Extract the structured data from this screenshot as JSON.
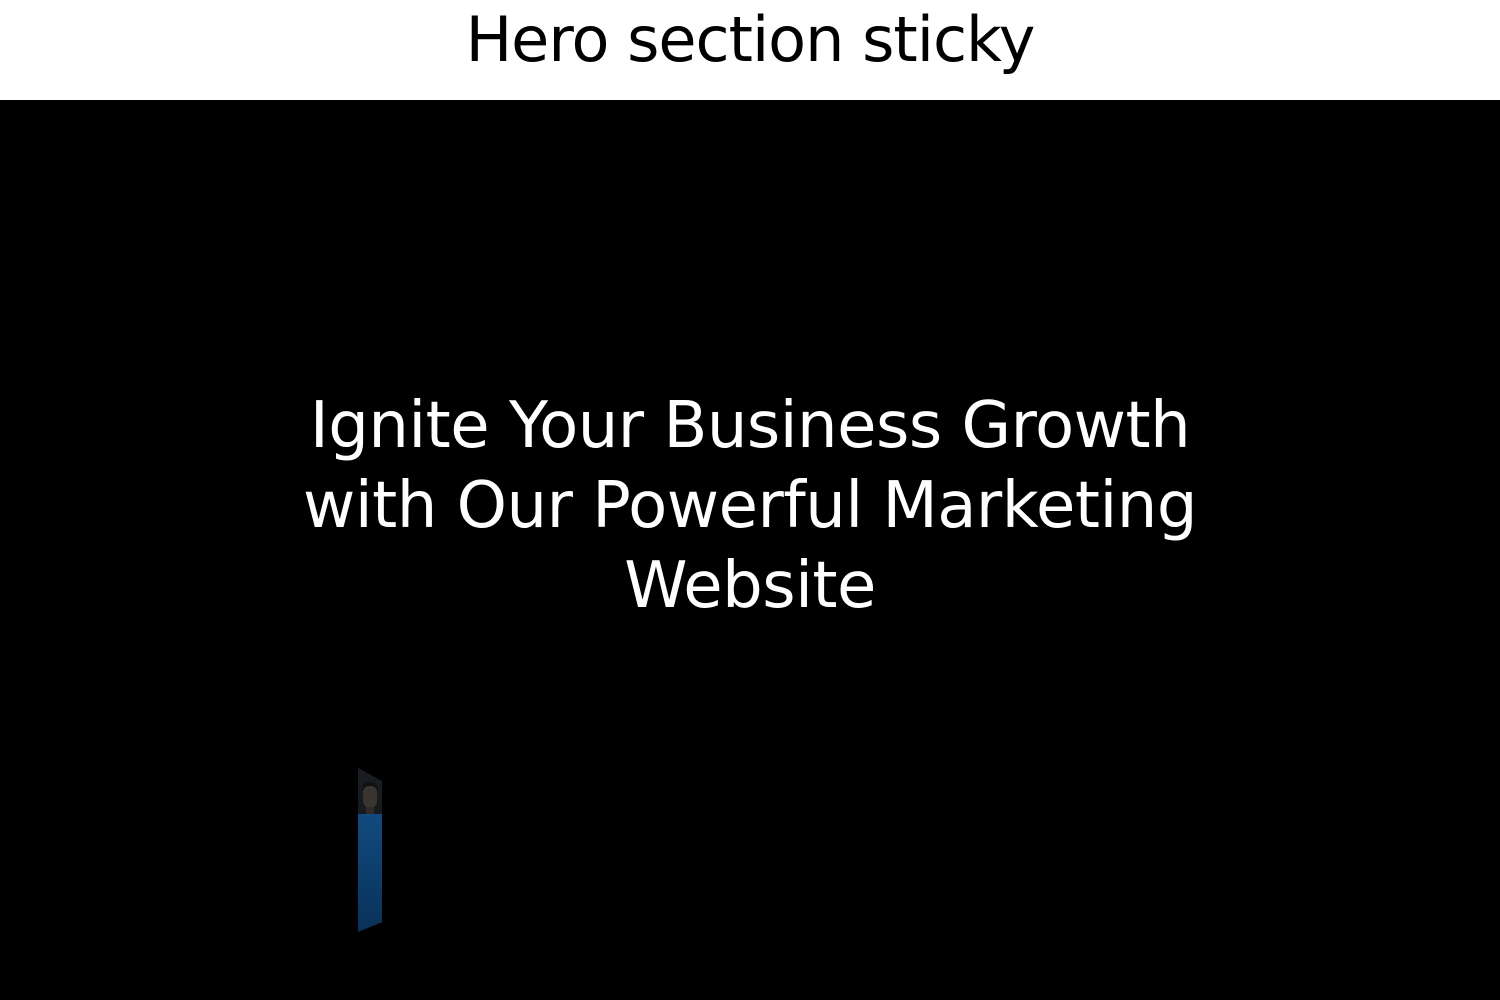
{
  "page": {
    "title": "Hero section sticky"
  },
  "hero": {
    "headline": "Ignite Your Business Growth\nwith Our Powerful Marketing\nWebsite"
  },
  "colors": {
    "page_background": "#ffffff",
    "hero_background": "#000000",
    "headline_text": "#ffffff",
    "shirt_blue": "#0c3d6b"
  }
}
